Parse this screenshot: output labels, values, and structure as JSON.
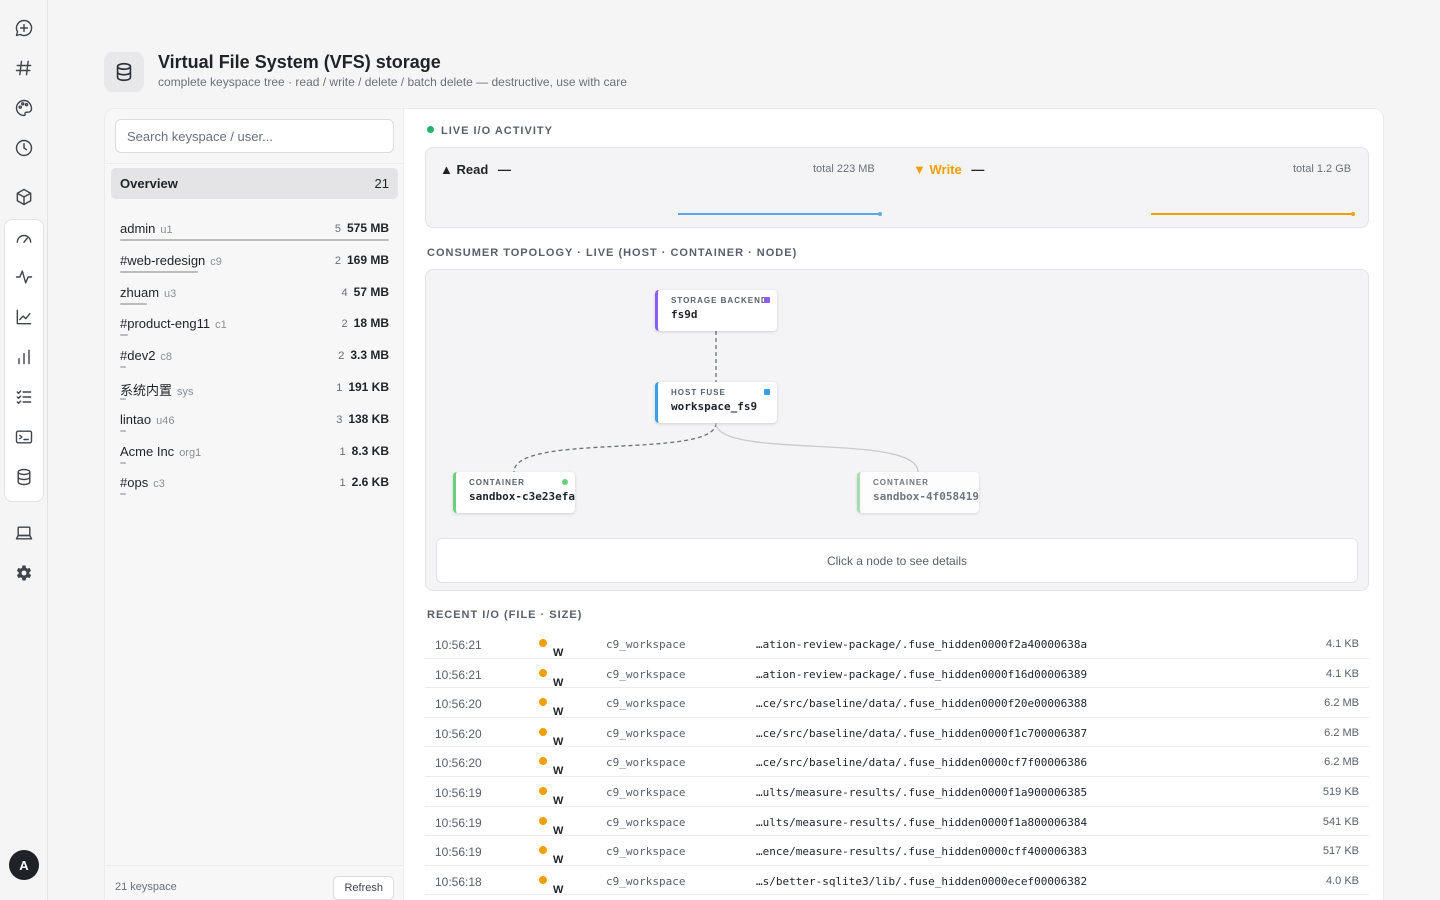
{
  "nav": {
    "items": [
      {
        "icon": "chat-plus-icon"
      },
      {
        "icon": "hash-icon"
      },
      {
        "icon": "palette-icon"
      },
      {
        "icon": "history-icon"
      },
      {
        "icon": "box-icon"
      },
      {
        "icon": "gauge-icon"
      },
      {
        "icon": "activity-icon"
      },
      {
        "icon": "line-chart-icon"
      },
      {
        "icon": "bar-chart-icon"
      },
      {
        "icon": "checklist-icon"
      },
      {
        "icon": "terminal-icon"
      },
      {
        "icon": "database-icon"
      },
      {
        "icon": "laptop-icon"
      },
      {
        "icon": "settings-icon"
      }
    ],
    "avatar": "A"
  },
  "header": {
    "title": "Virtual File System (VFS) storage",
    "subtitle": "complete keyspace tree · read / write / delete / batch delete — destructive, use with care"
  },
  "sidebar": {
    "search_placeholder": "Search keyspace / user...",
    "overview": {
      "label": "Overview",
      "count": "21"
    },
    "items": [
      {
        "name": "admin",
        "tag": "u1",
        "count": "5",
        "size": "575 MB",
        "share": 1.0
      },
      {
        "name": "#web-redesign",
        "tag": "c9",
        "count": "2",
        "size": "169 MB",
        "share": 0.29
      },
      {
        "name": "zhuam",
        "tag": "u3",
        "count": "4",
        "size": "57 MB",
        "share": 0.1
      },
      {
        "name": "#product-eng11",
        "tag": "c1",
        "count": "2",
        "size": "18 MB",
        "share": 0.03
      },
      {
        "name": "#dev2",
        "tag": "c8",
        "count": "2",
        "size": "3.3 MB",
        "share": 0.01
      },
      {
        "name": "系统内置",
        "tag": "sys",
        "count": "1",
        "size": "191 KB",
        "share": 0.005
      },
      {
        "name": "lintao",
        "tag": "u46",
        "count": "3",
        "size": "138 KB",
        "share": 0.005
      },
      {
        "name": "Acme Inc",
        "tag": "org1",
        "count": "1",
        "size": "8.3 KB",
        "share": 0.005
      },
      {
        "name": "#ops",
        "tag": "c3",
        "count": "1",
        "size": "2.6 KB",
        "share": 0.005
      }
    ],
    "footer_count": "21 keyspace",
    "refresh_label": "Refresh"
  },
  "live_io": {
    "title": "LIVE I/O ACTIVITY",
    "read": {
      "label": "▲ Read",
      "dash": "—",
      "total": "total 223 MB",
      "color": "#5aa9e6"
    },
    "write": {
      "label": "▼ Write",
      "dash": "—",
      "total": "total 1.2 GB",
      "color": "#f0a000"
    }
  },
  "topology": {
    "title": "CONSUMER TOPOLOGY · LIVE (HOST · CONTAINER · NODE)",
    "nodes": [
      {
        "kind": "STORAGE BACKEND",
        "name": "fs9d",
        "color": "#8b5cf6"
      },
      {
        "kind": "HOST FUSE",
        "name": "workspace_fs9",
        "color": "#3b9fe8"
      },
      {
        "kind": "CONTAINER",
        "name": "sandbox-c3e23efa",
        "color": "#6bd07a"
      },
      {
        "kind": "CONTAINER",
        "name": "sandbox-4f058419",
        "color": "#6bd07a"
      }
    ],
    "details_hint": "Click a node to see details"
  },
  "recent_io": {
    "title": "RECENT I/O (FILE · SIZE)",
    "rows": [
      {
        "time": "10:56:21",
        "op": "W",
        "workspace": "c9_workspace",
        "path": "…ation-review-package/.fuse_hidden0000f2a40000638a",
        "size": "4.1 KB"
      },
      {
        "time": "10:56:21",
        "op": "W",
        "workspace": "c9_workspace",
        "path": "…ation-review-package/.fuse_hidden0000f16d00006389",
        "size": "4.1 KB"
      },
      {
        "time": "10:56:20",
        "op": "W",
        "workspace": "c9_workspace",
        "path": "…ce/src/baseline/data/.fuse_hidden0000f20e00006388",
        "size": "6.2 MB"
      },
      {
        "time": "10:56:20",
        "op": "W",
        "workspace": "c9_workspace",
        "path": "…ce/src/baseline/data/.fuse_hidden0000f1c700006387",
        "size": "6.2 MB"
      },
      {
        "time": "10:56:20",
        "op": "W",
        "workspace": "c9_workspace",
        "path": "…ce/src/baseline/data/.fuse_hidden0000cf7f00006386",
        "size": "6.2 MB"
      },
      {
        "time": "10:56:19",
        "op": "W",
        "workspace": "c9_workspace",
        "path": "…ults/measure-results/.fuse_hidden0000f1a900006385",
        "size": "519 KB"
      },
      {
        "time": "10:56:19",
        "op": "W",
        "workspace": "c9_workspace",
        "path": "…ults/measure-results/.fuse_hidden0000f1a800006384",
        "size": "541 KB"
      },
      {
        "time": "10:56:19",
        "op": "W",
        "workspace": "c9_workspace",
        "path": "…ence/measure-results/.fuse_hidden0000cff400006383",
        "size": "517 KB"
      },
      {
        "time": "10:56:18",
        "op": "W",
        "workspace": "c9_workspace",
        "path": "…s/better-sqlite3/lib/.fuse_hidden0000ecef00006382",
        "size": "4.0 KB"
      }
    ]
  }
}
